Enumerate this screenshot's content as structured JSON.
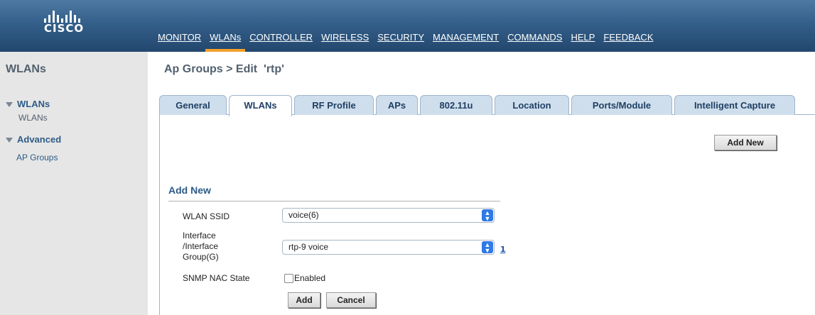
{
  "header": {
    "logo_text": "CISCO",
    "nav": [
      {
        "label": "MONITOR",
        "active": false
      },
      {
        "label": "WLANs",
        "active": true
      },
      {
        "label": "CONTROLLER",
        "active": false
      },
      {
        "label": "WIRELESS",
        "active": false
      },
      {
        "label": "SECURITY",
        "active": false
      },
      {
        "label": "MANAGEMENT",
        "active": false
      },
      {
        "label": "COMMANDS",
        "active": false
      },
      {
        "label": "HELP",
        "active": false
      },
      {
        "label": "FEEDBACK",
        "active": false
      }
    ],
    "accent_color": "#f2a12e"
  },
  "sidebar": {
    "title": "WLANs",
    "sections": [
      {
        "label": "WLANs",
        "items": [
          "WLANs"
        ]
      },
      {
        "label": "Advanced",
        "items": [
          "AP Groups"
        ]
      }
    ]
  },
  "main": {
    "title": "Ap Groups > Edit  'rtp'",
    "tabs": [
      {
        "label": "General",
        "active": false
      },
      {
        "label": "WLANs",
        "active": true
      },
      {
        "label": "RF Profile",
        "active": false
      },
      {
        "label": "APs",
        "active": false
      },
      {
        "label": "802.11u",
        "active": false
      },
      {
        "label": "Location",
        "active": false
      },
      {
        "label": "Ports/Module",
        "active": false
      },
      {
        "label": "Intelligent Capture",
        "active": false
      }
    ],
    "add_new_button": "Add New",
    "form": {
      "section_title": "Add New",
      "wlan_ssid_label": "WLAN SSID",
      "wlan_ssid_value": "voice(6)",
      "interface_label_1": "Interface",
      "interface_label_2": "/Interface",
      "interface_label_3": "Group(G)",
      "interface_value": "rtp-9 voice",
      "interface_help": "1",
      "snmp_label": "SNMP NAC State",
      "snmp_checkbox_label": "Enabled",
      "snmp_checked": false,
      "add_button": "Add",
      "cancel_button": "Cancel"
    }
  }
}
